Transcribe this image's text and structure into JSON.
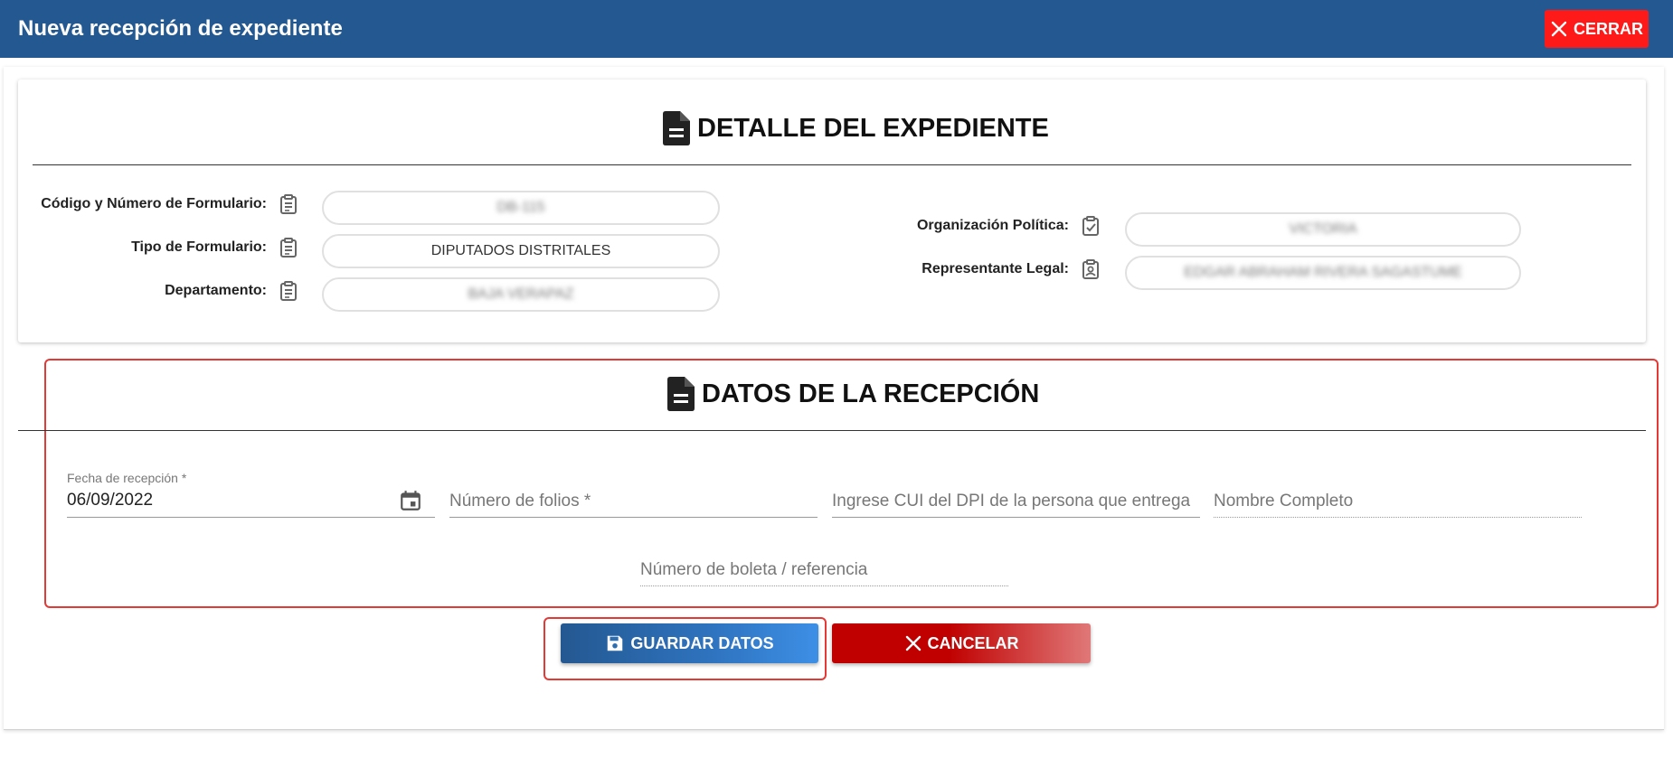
{
  "header": {
    "title": "Nueva recepción de expediente",
    "close_label": "CERRAR"
  },
  "detalle": {
    "title": "DETALLE DEL EXPEDIENTE",
    "fields_left": [
      {
        "label": "Código y Número de Formulario:",
        "value": "DB-115"
      },
      {
        "label": "Tipo de Formulario:",
        "value": "DIPUTADOS DISTRITALES"
      },
      {
        "label": "Departamento:",
        "value": "BAJA VERAPAZ"
      }
    ],
    "fields_right": [
      {
        "label": "Organización Política:",
        "value": "VICTORIA"
      },
      {
        "label": "Representante Legal:",
        "value": "EDGAR ABRAHAM RIVERA SAGASTUME"
      }
    ]
  },
  "recepcion": {
    "title": "DATOS DE LA RECEPCIÓN",
    "fecha_label": "Fecha de recepción *",
    "fecha_value": "06/09/2022",
    "folios_placeholder": "Número de folios *",
    "cui_placeholder": "Ingrese CUI del DPI de la persona que entrega",
    "nombre_placeholder": "Nombre Completo",
    "boleta_placeholder": "Número de boleta / referencia"
  },
  "actions": {
    "save_label": "GUARDAR DATOS",
    "cancel_label": "CANCELAR"
  },
  "colors": {
    "header": "#245891",
    "close": "#ff1a1a",
    "highlight": "#e53935"
  }
}
